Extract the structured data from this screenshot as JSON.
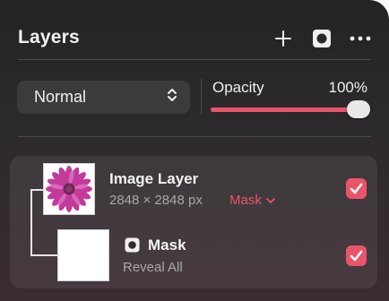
{
  "panel": {
    "title": "Layers",
    "add_icon": "plus-icon",
    "mask_icon": "mask-icon",
    "more_icon": "ellipsis-icon"
  },
  "blend_mode": {
    "value": "Normal",
    "icon": "chevron-up-down-icon"
  },
  "opacity": {
    "label": "Opacity",
    "value_text": "100%",
    "value": 1.0
  },
  "layers": [
    {
      "name": "Image Layer",
      "dimensions": "2848 × 2848 px",
      "mask_label": "Mask",
      "visible": true,
      "thumbnail": "pink-daisy-flower-image"
    },
    {
      "name": "Mask",
      "subtitle": "Reveal All",
      "visible": true,
      "thumbnail": "white-mask"
    }
  ],
  "colors": {
    "accent": "#e8556b",
    "panel_bg": "#2a2a2a"
  }
}
